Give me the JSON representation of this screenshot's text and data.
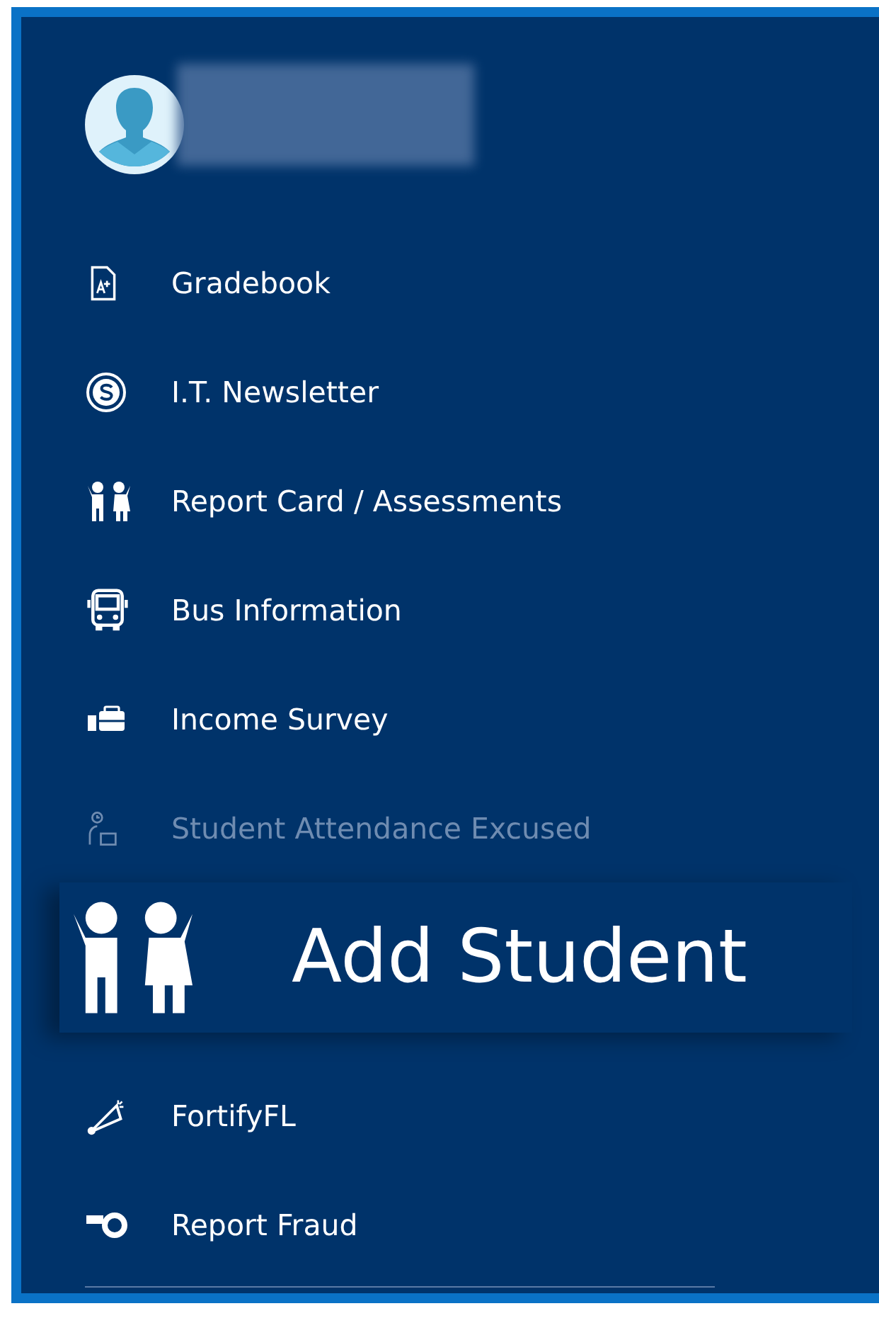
{
  "menu": {
    "items": [
      {
        "label": "Gradebook",
        "disabled": false
      },
      {
        "label": "I.T. Newsletter",
        "disabled": false
      },
      {
        "label": "Report Card / Assessments",
        "disabled": false
      },
      {
        "label": "Bus Information",
        "disabled": false
      },
      {
        "label": "Income Survey",
        "disabled": false
      },
      {
        "label": "Student Attendance Excused",
        "disabled": true
      }
    ],
    "callout": {
      "label": "Add Student"
    },
    "more_items": [
      {
        "label": "FortifyFL",
        "disabled": false
      },
      {
        "label": "Report Fraud",
        "disabled": false
      }
    ]
  }
}
